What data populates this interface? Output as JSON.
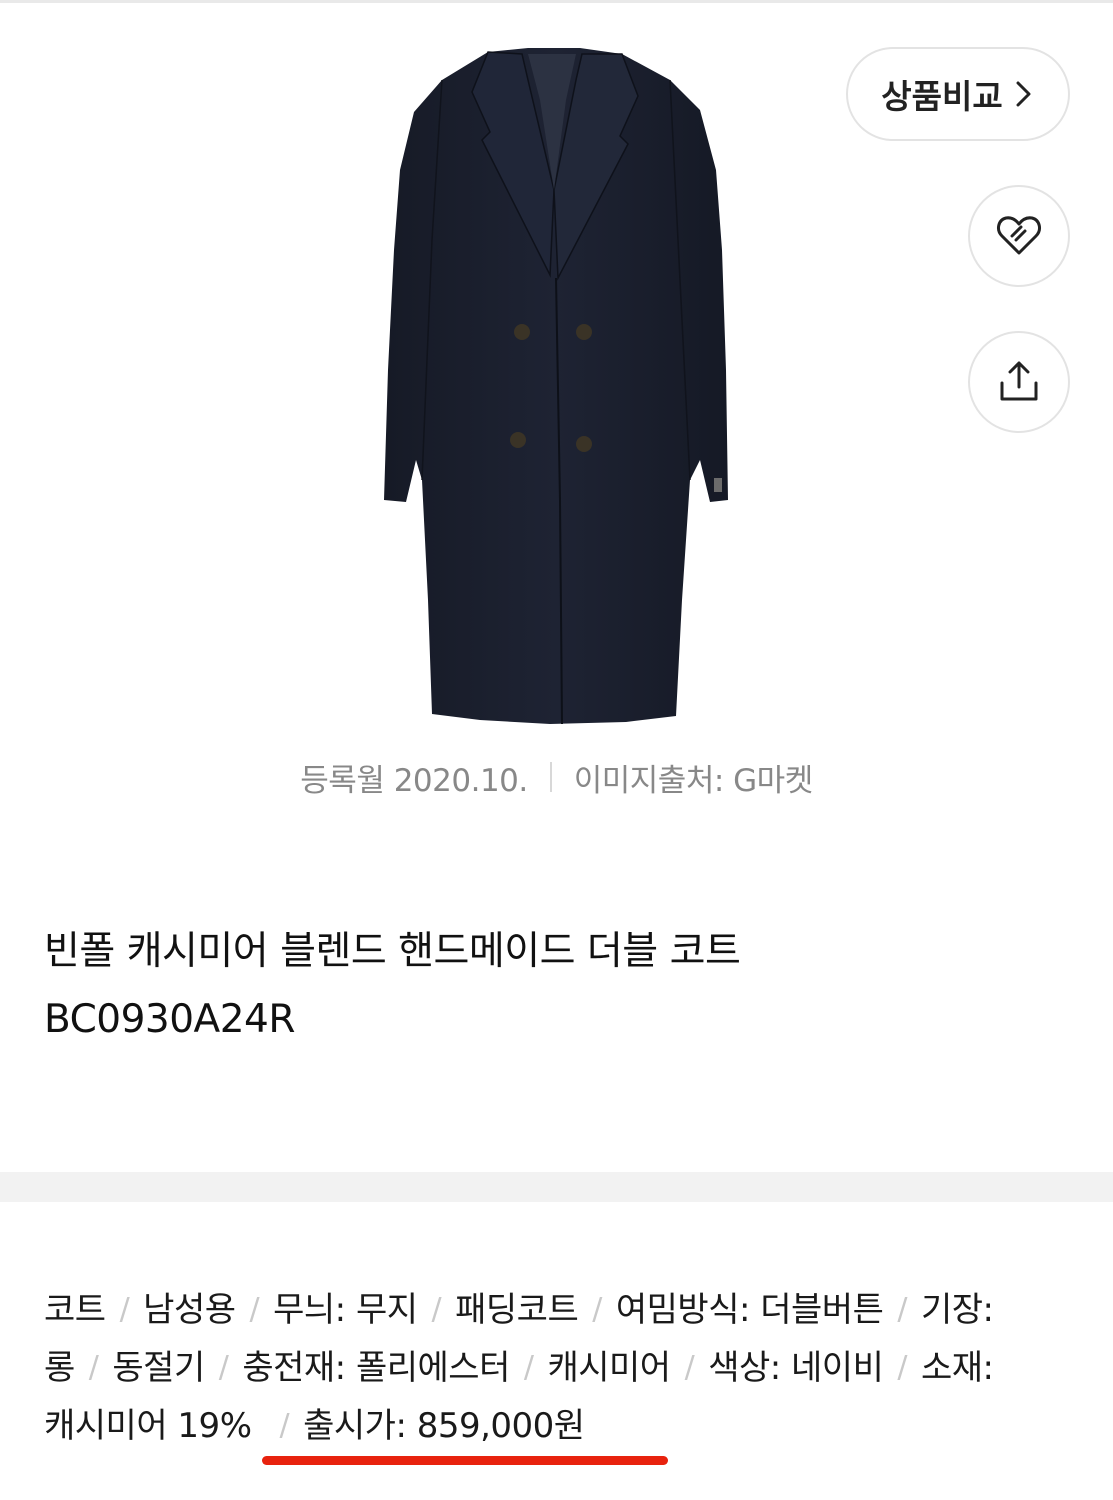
{
  "actions": {
    "compare_label": "상품비교",
    "wish_icon": "heart-icon",
    "share_icon": "share-icon"
  },
  "image_meta": {
    "registered": "등록월 2020.10.",
    "source": "이미지출처: G마켓"
  },
  "product": {
    "title_line1": "빈폴 캐시미어 블렌드 핸드메이드 더블 코트",
    "title_line2": "BC0930A24R"
  },
  "specs": {
    "separator": "/",
    "items": [
      "코트",
      "남성용",
      "무늬: 무지",
      "패딩코트",
      "여밈방식: 더블버튼",
      "기장:",
      "롱",
      "동절기",
      "충전재: 폴리에스터",
      "캐시미어",
      "색상: 네이비",
      "소재:",
      "캐시미어 19%",
      "출시가: 859,000원"
    ]
  },
  "colors": {
    "accent_underline": "#e8220e",
    "coat": "#1b2030"
  }
}
